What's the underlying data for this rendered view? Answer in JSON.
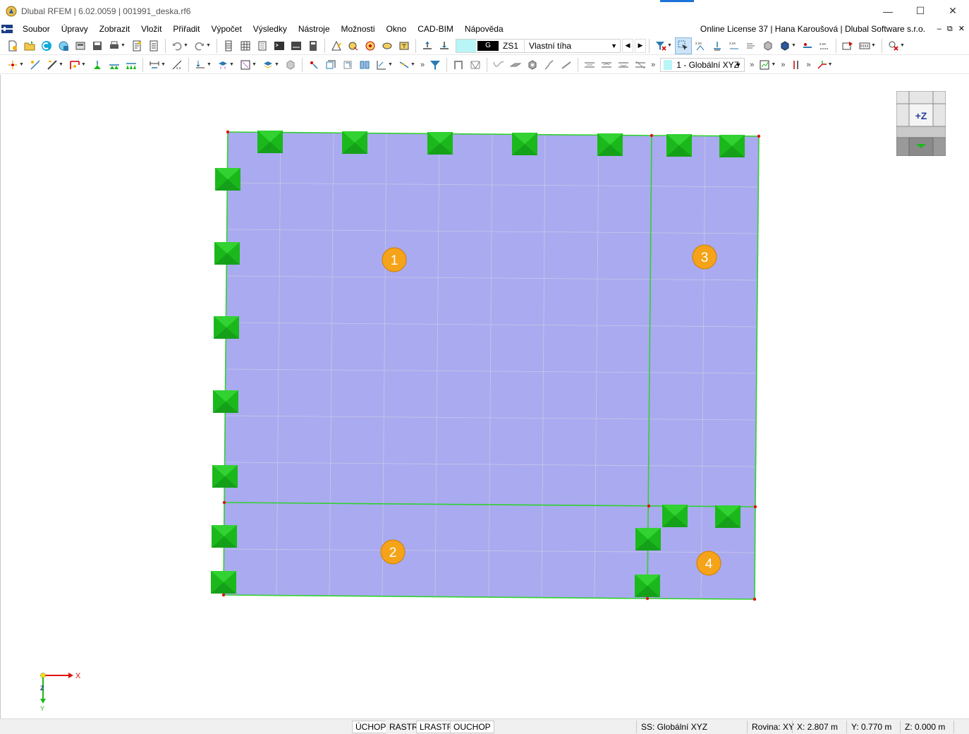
{
  "window": {
    "title": "Dlubal RFEM | 6.02.0059 | 001991_deska.rf6",
    "minimize_glyph": "—",
    "maximize_glyph": "☐",
    "close_glyph": "✕"
  },
  "menu": {
    "items": [
      "Soubor",
      "Úpravy",
      "Zobrazit",
      "Vložit",
      "Přiřadit",
      "Výpočet",
      "Výsledky",
      "Nástroje",
      "Možnosti",
      "Okno",
      "CAD-BIM",
      "Nápověda"
    ],
    "license": "Online License 37 | Hana Karoušová | Dlubal Software s.r.o.",
    "mdi_minimize": "–",
    "mdi_restore": "⧉",
    "mdi_close": "✕"
  },
  "toolbar": {
    "load_case_tag": "G",
    "load_case_id": "ZS1",
    "load_case_name": "Vlastní tíha",
    "coordinate_system": "1 - Globální XYZ",
    "overflow_glyph": "»"
  },
  "viewport": {
    "surface_labels": [
      "1",
      "2",
      "3",
      "4"
    ],
    "surface_color": "#aaaaf0",
    "edge_color": "#2fd12f",
    "support_color": "#1bb81b",
    "node_color": "#e01010",
    "label_color": "#f5a318",
    "navcube_label": "+Z",
    "axis_x": "X",
    "axis_y": "Y",
    "axis_z": "Z"
  },
  "statusbar": {
    "snap_buttons": [
      "ÚCHOP",
      "RASTR",
      "LRASTR",
      "OUCHOP"
    ],
    "coordinate_system": "SS: Globální XYZ",
    "plane": "Rovina: XY",
    "x": "X: 2.807 m",
    "y": "Y: 0.770 m",
    "z": "Z: 0.000 m"
  }
}
